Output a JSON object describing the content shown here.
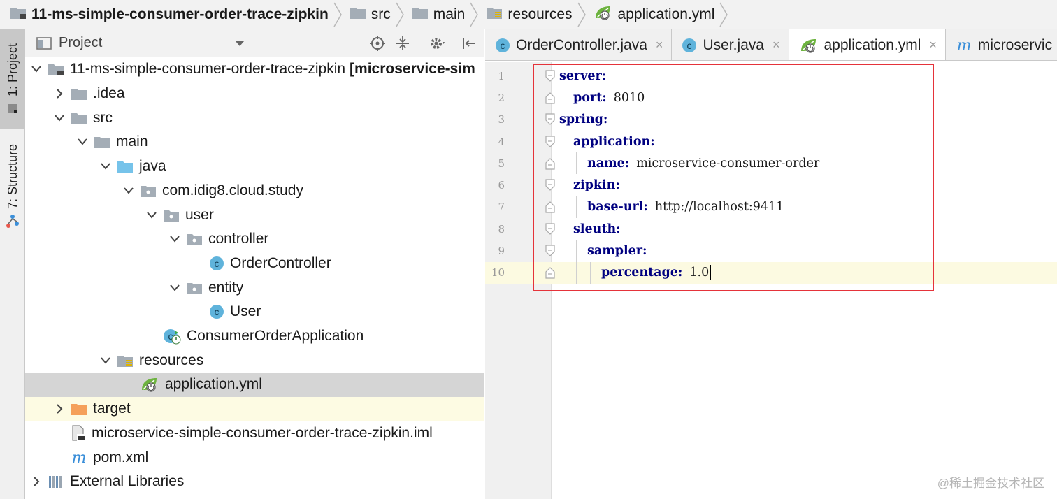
{
  "breadcrumb": [
    {
      "label": "11-ms-simple-consumer-order-trace-zipkin",
      "icon": "module-folder-icon",
      "bold": true
    },
    {
      "label": "src",
      "icon": "folder-icon"
    },
    {
      "label": "main",
      "icon": "folder-icon"
    },
    {
      "label": "resources",
      "icon": "resources-folder-icon"
    },
    {
      "label": "application.yml",
      "icon": "spring-yml-icon"
    }
  ],
  "toolstrip": {
    "project_tab": "1: Project",
    "structure_tab": "7: Structure"
  },
  "project_panel": {
    "title": "Project",
    "tree": [
      {
        "label": "11-ms-simple-consumer-order-trace-zipkin",
        "suffix": "[microservice-sim",
        "icon": "module-folder-icon",
        "arrow": "down",
        "indent": 0
      },
      {
        "label": ".idea",
        "icon": "folder-icon",
        "arrow": "right",
        "indent": 1
      },
      {
        "label": "src",
        "icon": "folder-icon",
        "arrow": "down",
        "indent": 1
      },
      {
        "label": "main",
        "icon": "folder-icon",
        "arrow": "down",
        "indent": 2
      },
      {
        "label": "java",
        "icon": "source-folder-icon",
        "arrow": "down",
        "indent": 3
      },
      {
        "label": "com.idig8.cloud.study",
        "icon": "package-icon",
        "arrow": "down",
        "indent": 4
      },
      {
        "label": "user",
        "icon": "package-icon",
        "arrow": "down",
        "indent": 5
      },
      {
        "label": "controller",
        "icon": "package-icon",
        "arrow": "down",
        "indent": 6
      },
      {
        "label": "OrderController",
        "icon": "class-icon",
        "arrow": "",
        "indent": 7
      },
      {
        "label": "entity",
        "icon": "package-icon",
        "arrow": "down",
        "indent": 6
      },
      {
        "label": "User",
        "icon": "class-icon",
        "arrow": "",
        "indent": 7
      },
      {
        "label": "ConsumerOrderApplication",
        "icon": "spring-boot-class-icon",
        "arrow": "",
        "indent": 5
      },
      {
        "label": "resources",
        "icon": "resources-folder-icon",
        "arrow": "down",
        "indent": 3
      },
      {
        "label": "application.yml",
        "icon": "spring-yml-icon",
        "arrow": "",
        "indent": 4,
        "selected": true
      },
      {
        "label": "target",
        "icon": "excluded-folder-icon",
        "arrow": "right",
        "indent": 1,
        "target": true
      },
      {
        "label": "microservice-simple-consumer-order-trace-zipkin.iml",
        "icon": "iml-file-icon",
        "arrow": "",
        "indent": 1
      },
      {
        "label": "pom.xml",
        "icon": "maven-icon",
        "arrow": "",
        "indent": 1
      },
      {
        "label": "External Libraries",
        "icon": "libraries-icon",
        "arrow": "right",
        "indent": 0
      }
    ]
  },
  "editor": {
    "tabs": [
      {
        "label": "OrderController.java",
        "icon": "class-icon",
        "close": "×"
      },
      {
        "label": "User.java",
        "icon": "class-icon",
        "close": "×"
      },
      {
        "label": "application.yml",
        "icon": "spring-yml-icon",
        "close": "×",
        "active": true
      },
      {
        "label": "microservic",
        "icon": "maven-icon",
        "close": ""
      }
    ],
    "lines": [
      {
        "num": "1",
        "indent": 0,
        "key": "server",
        "value": ""
      },
      {
        "num": "2",
        "indent": 1,
        "key": "port",
        "value": "8010"
      },
      {
        "num": "3",
        "indent": 0,
        "key": "spring",
        "value": ""
      },
      {
        "num": "4",
        "indent": 1,
        "key": "application",
        "value": ""
      },
      {
        "num": "5",
        "indent": 2,
        "key": "name",
        "value": "microservice-consumer-order"
      },
      {
        "num": "6",
        "indent": 1,
        "key": "zipkin",
        "value": ""
      },
      {
        "num": "7",
        "indent": 2,
        "key": "base-url",
        "value": "http://localhost:9411"
      },
      {
        "num": "8",
        "indent": 1,
        "key": "sleuth",
        "value": ""
      },
      {
        "num": "9",
        "indent": 2,
        "key": "sampler",
        "value": ""
      },
      {
        "num": "10",
        "indent": 3,
        "key": "percentage",
        "value": "1.0",
        "current": true
      }
    ]
  },
  "watermark": "@稀土掘金技术社区",
  "colors": {
    "yaml_key": "#000080",
    "highlight_box": "#e5333a",
    "selected_row": "#d5d5d5",
    "current_line": "#fcfae1"
  }
}
